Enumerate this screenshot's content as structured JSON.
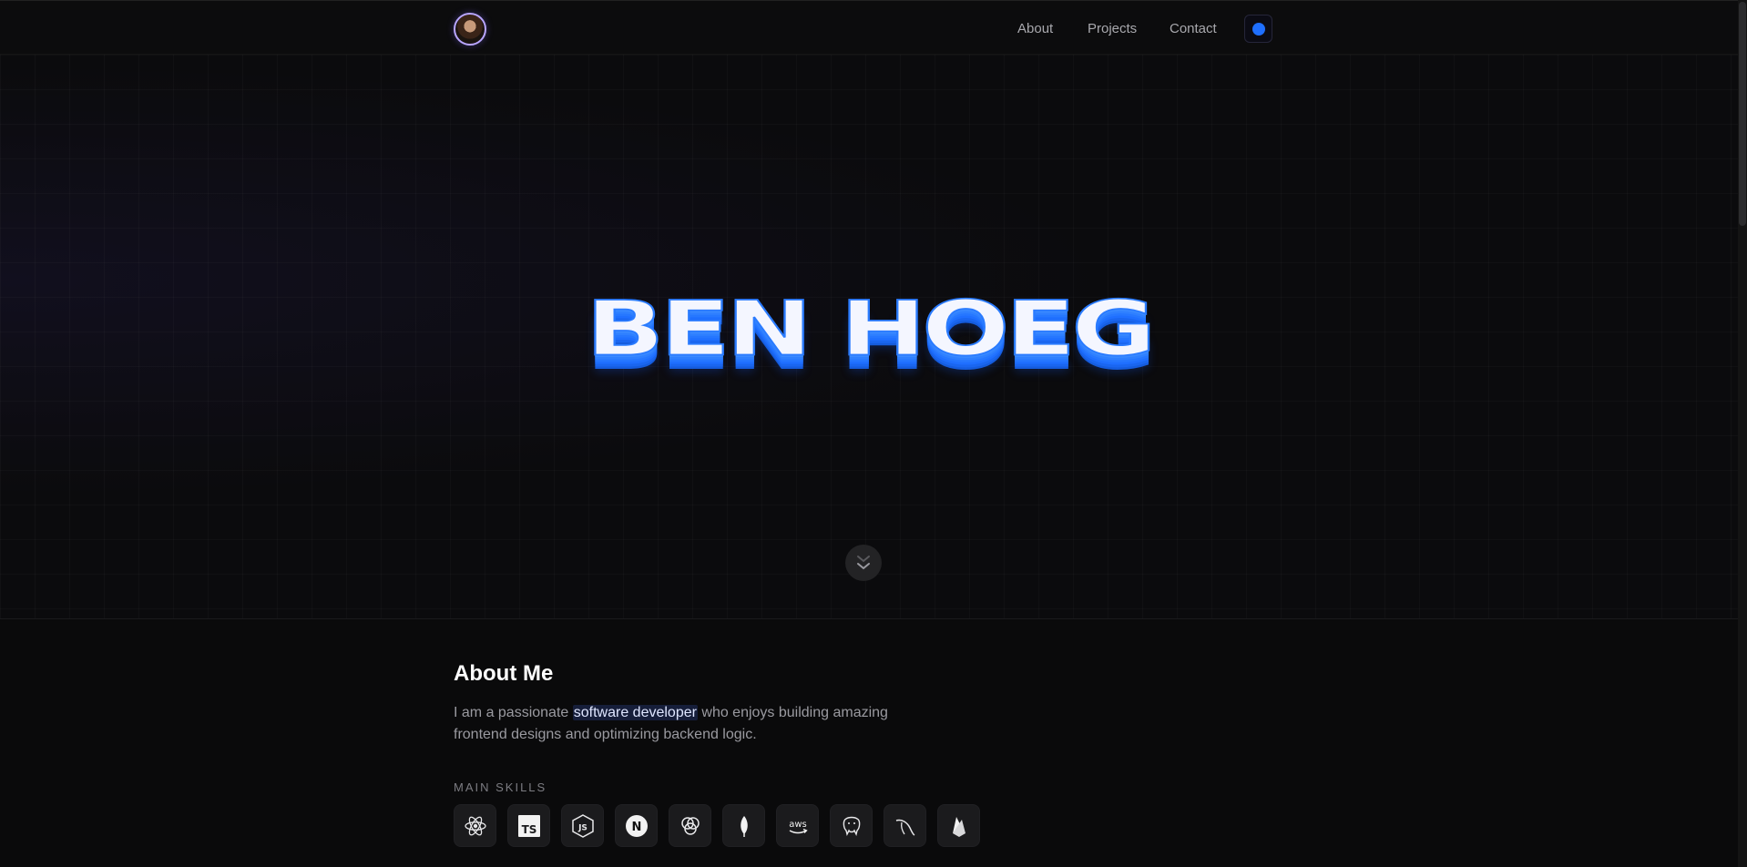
{
  "nav": {
    "about": "About",
    "projects": "Projects",
    "contact": "Contact"
  },
  "hero": {
    "title": "BEN HOEG"
  },
  "about": {
    "title": "About Me",
    "text_before": "I am a passionate ",
    "highlight": "software developer",
    "text_after": " who enjoys building amazing frontend designs and optimizing backend logic.",
    "skills_label": "MAIN SKILLS"
  },
  "skills": [
    {
      "icon": "react-icon"
    },
    {
      "icon": "typescript-icon",
      "text": "TS"
    },
    {
      "icon": "javascript-icon",
      "text": "JS"
    },
    {
      "icon": "nextjs-icon",
      "text": "N"
    },
    {
      "icon": "graphql-icon"
    },
    {
      "icon": "mongodb-icon"
    },
    {
      "icon": "aws-icon",
      "text": "aws"
    },
    {
      "icon": "postgresql-icon"
    },
    {
      "icon": "mysql-icon"
    },
    {
      "icon": "firebase-icon"
    }
  ],
  "colors": {
    "accent": "#1f6fff",
    "background": "#0a0a0b",
    "avatar_ring": "#b9a6ff"
  }
}
